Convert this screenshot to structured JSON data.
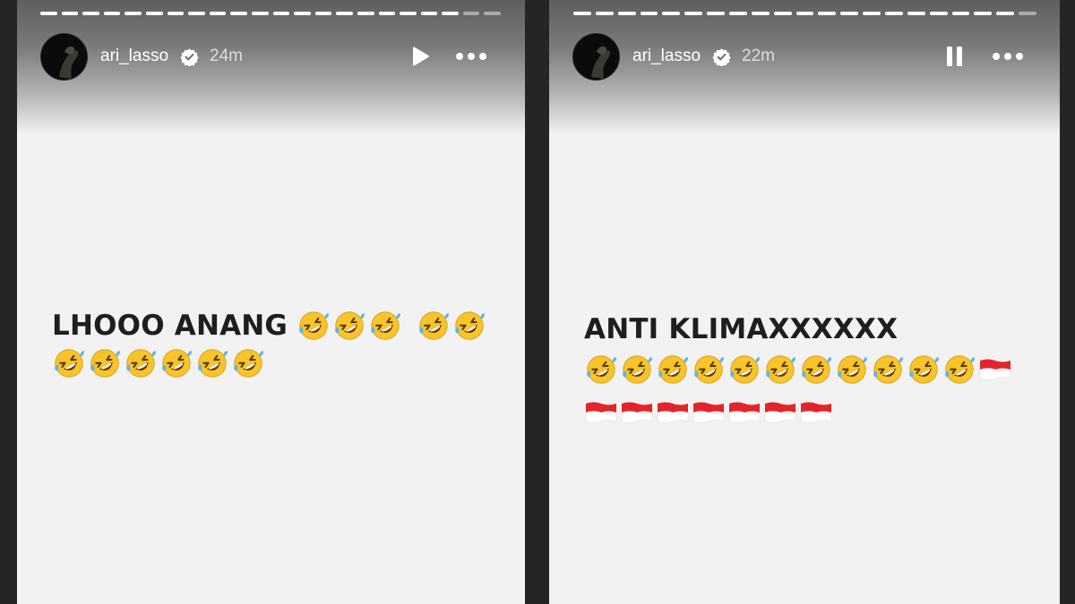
{
  "stories": [
    {
      "username": "ari_lasso",
      "timestamp": "24m",
      "playback_control": "play",
      "progress_segments": 22,
      "progress_seen": 20,
      "caption": "LHOOO ANANG",
      "caption_emojis": [
        "rofl",
        "rofl",
        "rofl",
        "gap",
        "rofl",
        "rofl"
      ],
      "emoji_rows": [
        [
          "rofl",
          "rofl",
          "rofl",
          "rofl",
          "rofl",
          "rofl"
        ]
      ]
    },
    {
      "username": "ari_lasso",
      "timestamp": "22m",
      "playback_control": "pause",
      "progress_segments": 21,
      "progress_seen": 20,
      "caption": "ANTI KLIMAXXXXXX",
      "caption_emojis": [],
      "emoji_rows": [
        [
          "rofl",
          "rofl",
          "rofl",
          "rofl",
          "rofl",
          "rofl",
          "rofl",
          "rofl",
          "rofl",
          "rofl",
          "rofl",
          "flag-indonesia"
        ],
        [
          "flag-indonesia",
          "flag-indonesia",
          "flag-indonesia",
          "flag-indonesia",
          "flag-indonesia",
          "flag-indonesia",
          "flag-indonesia"
        ]
      ]
    }
  ],
  "colors": {
    "story_background": "#f2f2f2",
    "page_background": "#252525",
    "caption_text": "#1e1e1e",
    "emoji_yellow": "#f7c42c",
    "flag_red": "#e3242b",
    "flag_white": "#ffffff"
  }
}
